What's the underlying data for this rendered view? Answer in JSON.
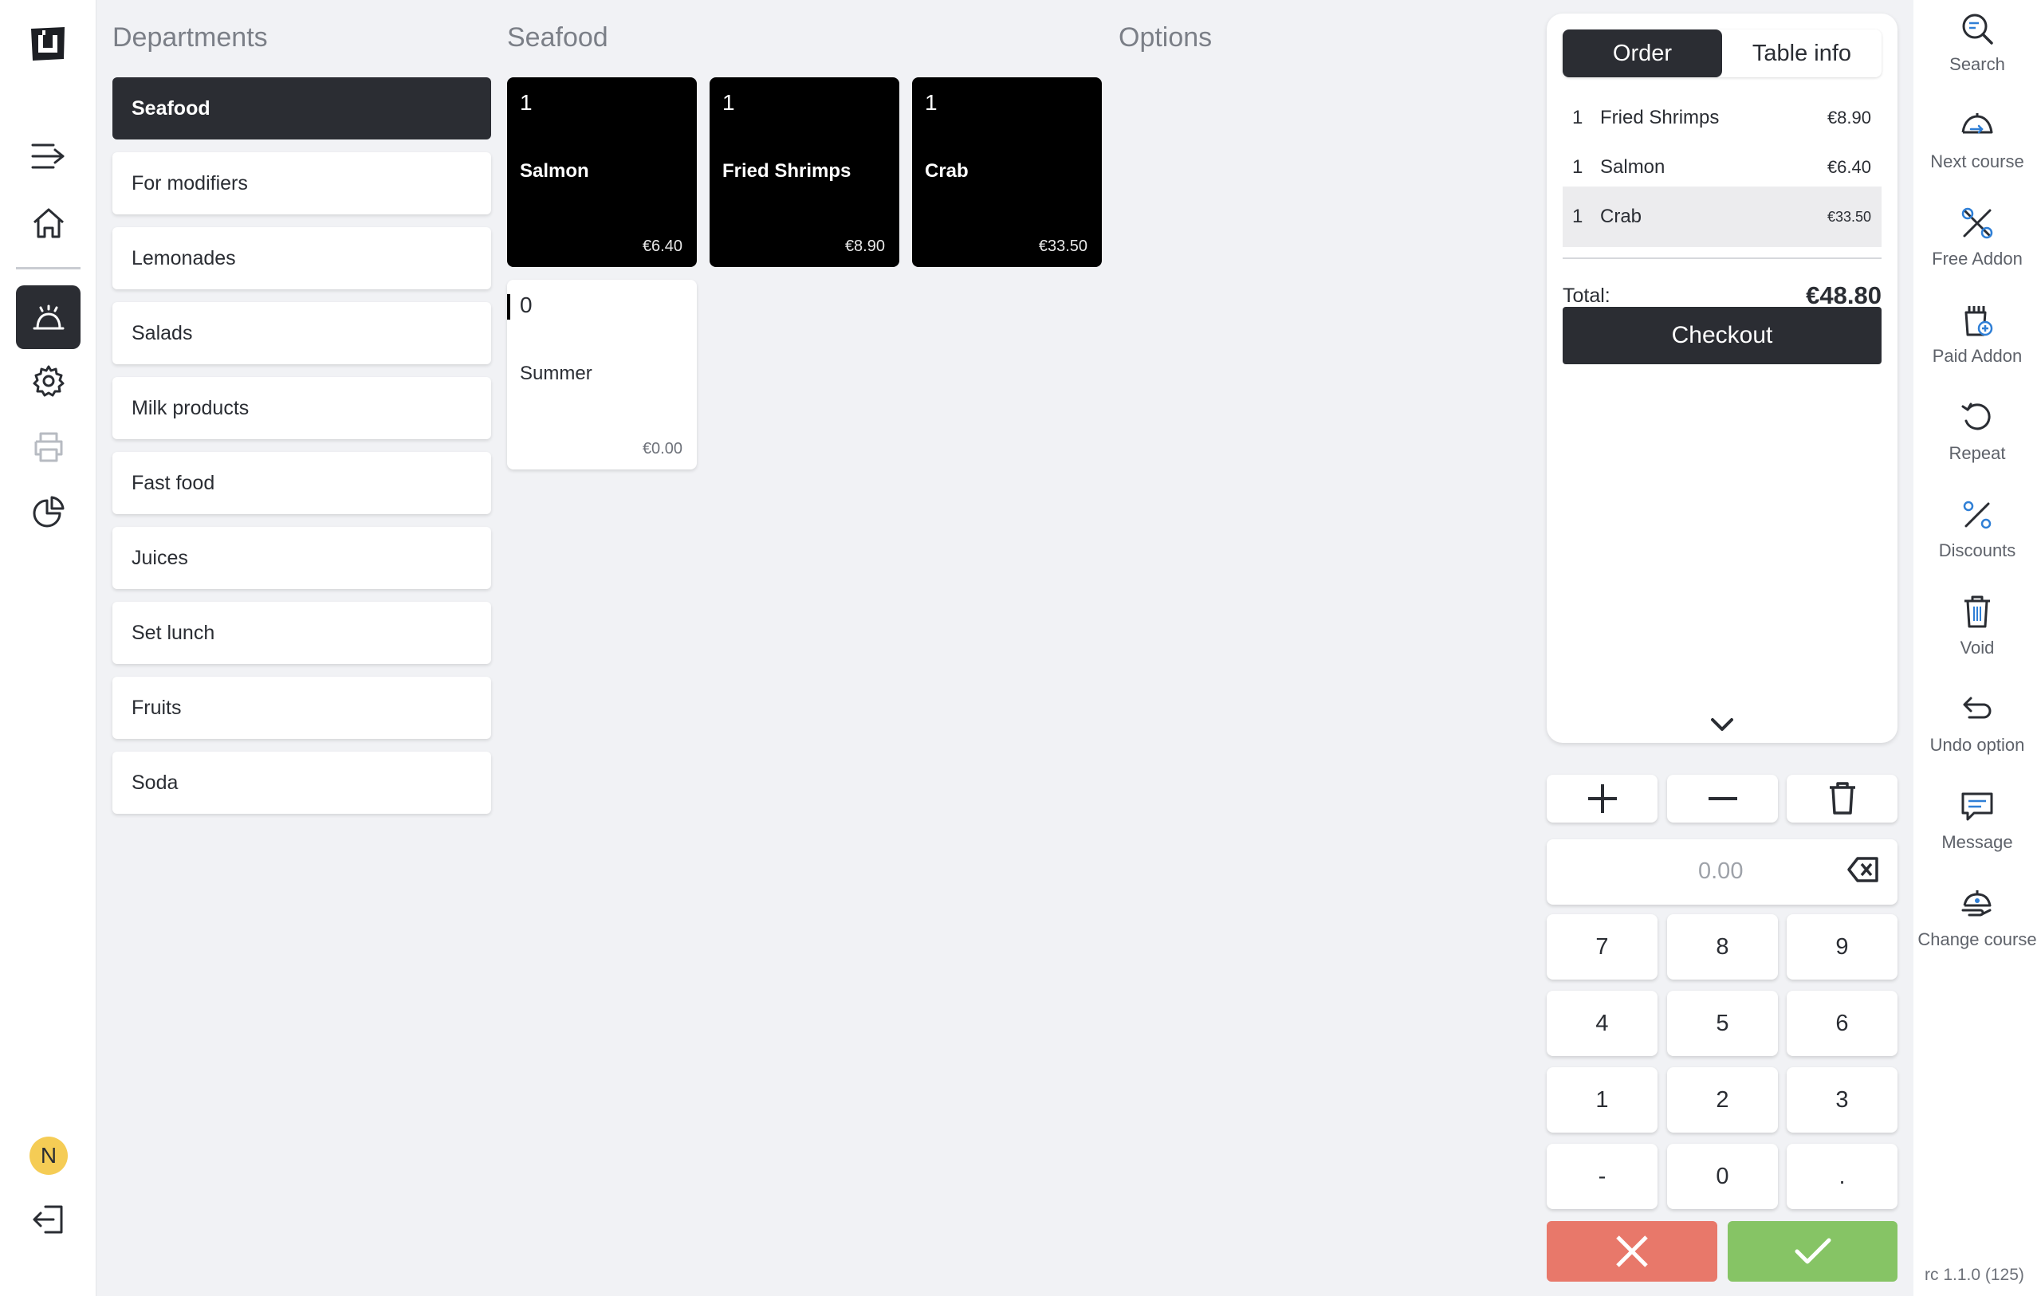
{
  "leftnav": {
    "logo": "u-logo-icon",
    "items": [
      {
        "icon": "expand-menu-icon"
      },
      {
        "icon": "home-icon"
      },
      {
        "icon": "service-bell-icon",
        "active": true
      },
      {
        "icon": "gear-icon"
      },
      {
        "icon": "printer-icon",
        "disabled": true
      },
      {
        "icon": "pie-chart-icon"
      }
    ],
    "user_initial": "N",
    "logout_icon": "logout-icon"
  },
  "departments": {
    "title": "Departments",
    "items": [
      "Seafood",
      "For modifiers",
      "Lemonades",
      "Salads",
      "Milk products",
      "Fast food",
      "Juices",
      "Set lunch",
      "Fruits",
      "Soda"
    ],
    "active": "Seafood"
  },
  "products": {
    "title": "Seafood",
    "items": [
      {
        "qty": "1",
        "name": "Salmon",
        "price": "€6.40"
      },
      {
        "qty": "1",
        "name": "Fried Shrimps",
        "price": "€8.90"
      },
      {
        "qty": "1",
        "name": "Crab",
        "price": "€33.50"
      },
      {
        "qty": "0",
        "name": "Summer",
        "price": "€0.00"
      }
    ]
  },
  "options": {
    "title": "Options"
  },
  "order": {
    "tabs": [
      "Order",
      "Table info"
    ],
    "active_tab": "Order",
    "lines": [
      {
        "qty": "1",
        "name": "Fried Shrimps",
        "price": "€8.90"
      },
      {
        "qty": "1",
        "name": "Salmon",
        "price": "€6.40"
      },
      {
        "qty": "1",
        "name": "Crab",
        "price": "€33.50"
      }
    ],
    "selected_line": 2,
    "total_label": "Total:",
    "total_value": "€48.80",
    "checkout_label": "Checkout"
  },
  "keypad": {
    "amount": "0.00",
    "keys": [
      "7",
      "8",
      "9",
      "4",
      "5",
      "6",
      "1",
      "2",
      "3",
      "-",
      "0",
      "."
    ],
    "cancel_color": "#e8786a",
    "confirm_color": "#86c465"
  },
  "actions": [
    {
      "label": "Search",
      "icon": "search-icon"
    },
    {
      "label": "Next course",
      "icon": "next-course-icon"
    },
    {
      "label": "Free Addon",
      "icon": "free-addon-icon"
    },
    {
      "label": "Paid Addon",
      "icon": "paid-addon-icon"
    },
    {
      "label": "Repeat",
      "icon": "repeat-icon"
    },
    {
      "label": "Discounts",
      "icon": "percent-icon"
    },
    {
      "label": "Void",
      "icon": "trash-icon"
    },
    {
      "label": "Undo option",
      "icon": "undo-icon"
    },
    {
      "label": "Message",
      "icon": "message-icon"
    },
    {
      "label": "Change course",
      "icon": "change-course-icon"
    }
  ],
  "version": "rc 1.1.0 (125)",
  "colors": {
    "dark": "#2b2d33",
    "accent_blue": "#2f7fd6",
    "avatar": "#f5cc55"
  }
}
